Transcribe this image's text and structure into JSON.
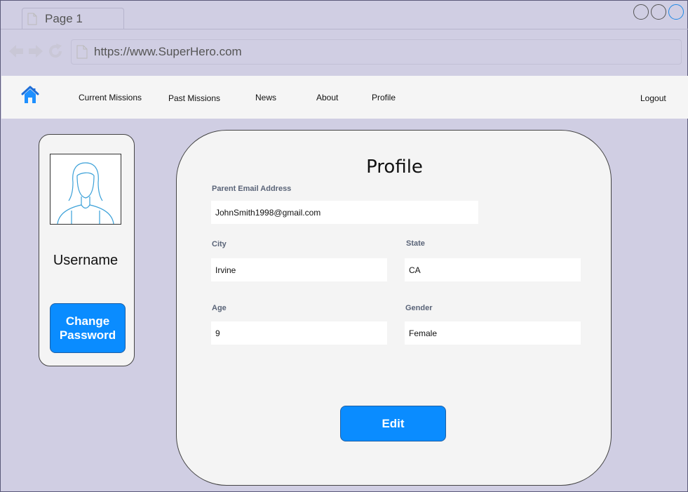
{
  "browser": {
    "tab_title": "Page 1",
    "url": "https://www.SuperHero.com"
  },
  "nav": {
    "items": [
      {
        "label": "Current Missions"
      },
      {
        "label": "Past Missions"
      },
      {
        "label": "News"
      },
      {
        "label": "About"
      },
      {
        "label": "Profile"
      }
    ],
    "logout": "Logout"
  },
  "user_card": {
    "username": "Username",
    "change_password": "Change\nPassword"
  },
  "profile": {
    "title": "Profile",
    "fields": {
      "email": {
        "label": "Parent Email Address",
        "value": "JohnSmith1998@gmail.com"
      },
      "city": {
        "label": "City",
        "value": "Irvine"
      },
      "state": {
        "label": "State",
        "value": "CA"
      },
      "age": {
        "label": "Age",
        "value": "9"
      },
      "gender": {
        "label": "Gender",
        "value": "Female"
      }
    },
    "edit_label": "Edit"
  },
  "colors": {
    "background": "#d0cee3",
    "accent": "#0a8cff",
    "navbar": "#f5f5f5"
  },
  "icons": [
    "document-icon",
    "back-arrow-icon",
    "forward-arrow-icon",
    "refresh-icon",
    "home-icon",
    "avatar-icon",
    "window-button-icon"
  ]
}
